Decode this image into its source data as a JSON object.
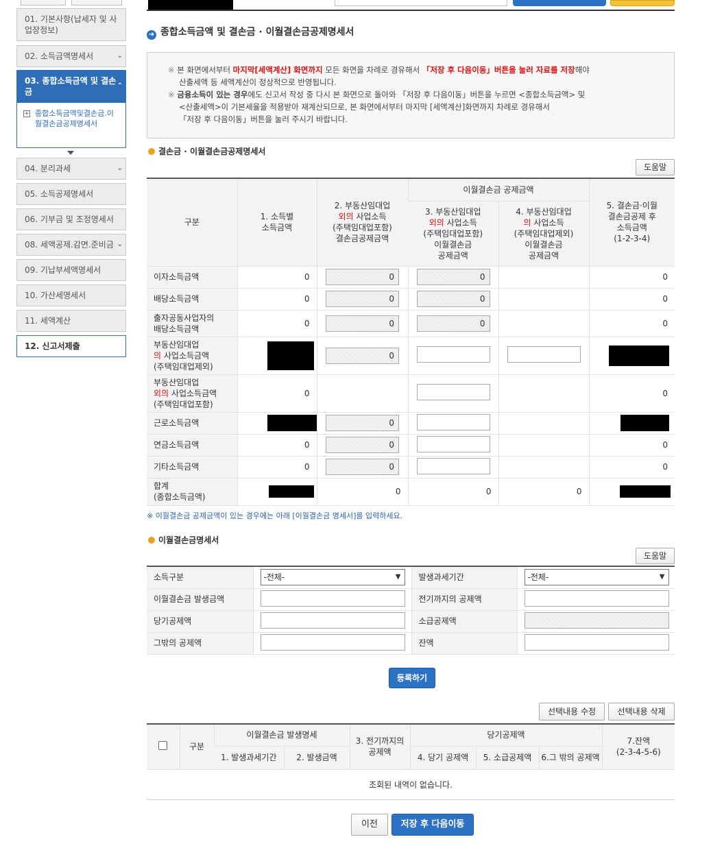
{
  "sidebar": {
    "items": [
      {
        "label": "01. 기본사항(납세자 및 사업장정보)"
      },
      {
        "label": "02. 소득금액명세서"
      },
      {
        "label": "03. 종합소득금액 및 결손금"
      },
      {
        "label": "04. 분리과세"
      },
      {
        "label": "05. 소득공제명세서"
      },
      {
        "label": "06. 기부금 및 조정명세서"
      },
      {
        "label": "08. 세액공제.감면.준비금"
      },
      {
        "label": "09. 기납부세액명세서"
      },
      {
        "label": "10. 가산세명세서"
      },
      {
        "label": "11. 세액계산"
      },
      {
        "label": "12. 신고서제출"
      }
    ],
    "sub_label": "종합소득금액및결손금.이월결손금공제명세서"
  },
  "page_title": "종합소득금액 및 결손금 · 이월결손금공제명세서",
  "notice": {
    "l1a": "본 화면에서부터 ",
    "l1b": "마지막[세액계산] 화면까지",
    "l1c": " 모든 화면을 차례로 경유해서 ",
    "l1d": "「저장 후 다음이동」버튼을 눌러 자료를 저장",
    "l1e": "해야",
    "l2": "산출세액 등 세액계산이 정상적으로 반영됩니다.",
    "l3a": "금융소득이 있는 경우",
    "l3b": "에도 신고서 작성 중 다시 본 화면으로 돌아와 「저장 후 다음이동」버튼을 누르면 <종합소득금액> 및",
    "l4": "<산출세액>이 기본세율을 적용받아 재계산되므로, 본 화면에서부터 마지막 [세액계산]화면까지 차례로 경유해서",
    "l5": "「저장 후 다음이동」버튼을 눌러 주시기 바랍니다."
  },
  "section1": {
    "title": "결손금 · 이월결손금공제명세서",
    "help": "도움말",
    "headers": {
      "gubun": "구분",
      "c1": "1. 소득별 소득금액",
      "c2a": "2. 부동산임대업",
      "c2b": "외의",
      "c2c": " 사업소득",
      "c2d": "(주택임대업포함)",
      "c2e": "결손금공제금액",
      "group": "이월결손금 공제금액",
      "c3a": "3. 부동산임대업",
      "c3b": "외의",
      "c3c": " 사업소득",
      "c3d": "(주택임대업포함)",
      "c3e": "이월결손금",
      "c3f": "공제금액",
      "c4a": "4. 부동산임대업",
      "c4b": "의",
      "c4c": " 사업소득",
      "c4d": "(주택임대업제외)",
      "c4e": "이월결손금",
      "c4f": "공제금액",
      "c5a": "5. 결손금·이월",
      "c5b": "결손금공제 후",
      "c5c": "소득금액",
      "c5d": "(1-2-3-4)"
    },
    "rows": {
      "r1": {
        "label": "이자소득금액",
        "c1": "0",
        "c2": "0",
        "c3": "0",
        "c5": "0"
      },
      "r2": {
        "label": "배당소득금액",
        "c1": "0",
        "c2": "0",
        "c3": "0",
        "c5": "0"
      },
      "r3": {
        "label1": "출자공동사업자의",
        "label2": "배당소득금액",
        "c1": "0",
        "c2": "0",
        "c3": "0",
        "c5": "0"
      },
      "r4": {
        "label1": "부동산임대업",
        "label2a": "의",
        "label2b": " 사업소득금액",
        "label3": "(주택임대업제외)",
        "c2": "0"
      },
      "r5": {
        "label1": "부동산임대업",
        "label2a": "외의",
        "label2b": " 사업소득금액",
        "label3": "(주택임대업포함)",
        "c1": "0",
        "c5": "0"
      },
      "r6": {
        "label": "근로소득금액",
        "c2": "0"
      },
      "r7": {
        "label": "연금소득금액",
        "c1": "0",
        "c2": "0",
        "c5": "0"
      },
      "r8": {
        "label": "기타소득금액",
        "c1": "0",
        "c2": "0",
        "c5": "0"
      },
      "r9": {
        "label1": "합계",
        "label2": "(종합소득금액)",
        "c2": "0",
        "c3": "0",
        "c4": "0"
      }
    },
    "footnote": "※ 이월결손금 공제금액이 있는 경우에는 아래 [이월결손금 명세서]를 입력하세요."
  },
  "section2": {
    "title": "이월결손금명세서",
    "help": "도움말",
    "labels": {
      "income_type": "소득구분",
      "period": "발생과세기간",
      "occur_amt": "이월결손금 발생금액",
      "prev_deduct": "전기까지의 공제액",
      "cur_deduct": "당기공제액",
      "refund_deduct": "소급공제액",
      "other_deduct": "그밖의 공제액",
      "balance": "잔액"
    },
    "income_type_value": "-전체-",
    "period_value": "-전체-",
    "register": "등록하기",
    "edit": "선택내용 수정",
    "delete": "선택내용 삭제"
  },
  "list": {
    "h_gubun": "구분",
    "h_group1": "이월결손금 발생명세",
    "h_period": "1. 발생과세기간",
    "h_amt": "2. 발생금액",
    "h_prev1": "3. 전기까지의",
    "h_prev2": "공제액",
    "h_group2": "당기공제액",
    "h_cur": "4. 당기 공제액",
    "h_refund": "5. 소급공제액",
    "h_other": "6.그 밖의 공제액",
    "h_bal1": "7.잔액",
    "h_bal2": "(2-3-4-5-6)",
    "empty": "조회된 내역이 없습니다."
  },
  "footer": {
    "prev": "이전",
    "save_next": "저장 후 다음이동"
  }
}
